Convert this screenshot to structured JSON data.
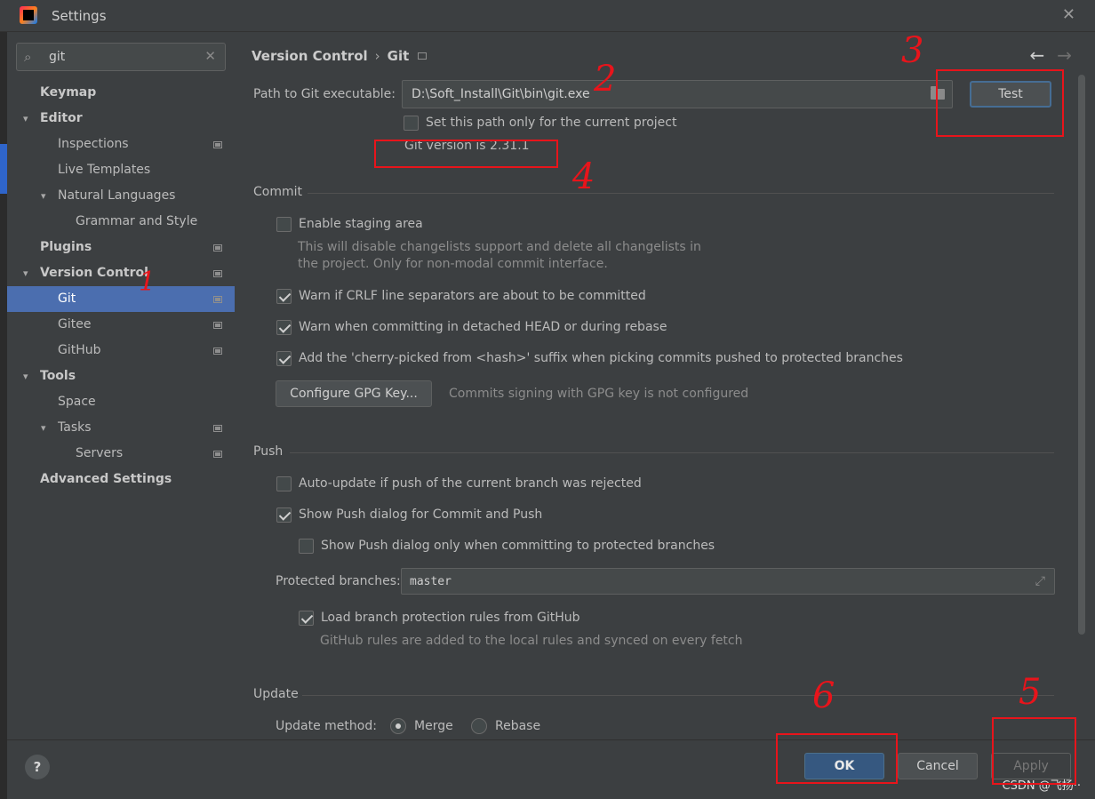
{
  "window": {
    "title": "Settings",
    "close_glyph": "✕"
  },
  "search": {
    "value": "git",
    "search_glyph": "⌕",
    "clear_glyph": "✕"
  },
  "tree": {
    "collapse_glyph": "▾",
    "items": [
      {
        "label": "Keymap"
      },
      {
        "label": "Editor"
      },
      {
        "label": "Inspections"
      },
      {
        "label": "Live Templates"
      },
      {
        "label": "Natural Languages"
      },
      {
        "label": "Grammar and Style"
      },
      {
        "label": "Plugins"
      },
      {
        "label": "Version Control"
      },
      {
        "label": "Git"
      },
      {
        "label": "Gitee"
      },
      {
        "label": "GitHub"
      },
      {
        "label": "Tools"
      },
      {
        "label": "Space"
      },
      {
        "label": "Tasks"
      },
      {
        "label": "Servers"
      },
      {
        "label": "Advanced Settings"
      }
    ]
  },
  "breadcrumb": {
    "parent": "Version Control",
    "separator": "›",
    "current": "Git",
    "back_glyph": "←",
    "forward_glyph": "→"
  },
  "git": {
    "path_label": "Path to Git executable:",
    "path_value": "D:\\Soft_Install\\Git\\bin\\git.exe",
    "test_button": "Test",
    "project_only_label": "Set this path only for the current project",
    "version_text": "Git version is 2.31.1"
  },
  "commit": {
    "section_title": "Commit",
    "staging_label": "Enable staging area",
    "staging_hint_1": "This will disable changelists support and delete all changelists in",
    "staging_hint_2": "the project. Only for non-modal commit interface.",
    "crlf_label": "Warn if CRLF line separators are about to be committed",
    "detached_label": "Warn when committing in detached HEAD or during rebase",
    "cherry_label": "Add the 'cherry-picked from <hash>' suffix when picking commits pushed to protected branches",
    "gpg_button": "Configure GPG Key...",
    "gpg_status": "Commits signing with GPG key is not configured"
  },
  "push": {
    "section_title": "Push",
    "auto_update_label": "Auto-update if push of the current branch was rejected",
    "show_dialog_label": "Show Push dialog for Commit and Push",
    "protected_only_label": "Show Push dialog only when committing to protected branches",
    "protected_branches_label": "Protected branches:",
    "protected_branches_value": "master",
    "expand_glyph": "⤢",
    "load_rules_label": "Load branch protection rules from GitHub",
    "load_rules_hint": "GitHub rules are added to the local rules and synced on every fetch"
  },
  "update": {
    "section_title": "Update",
    "method_label": "Update method:",
    "merge_label": "Merge",
    "rebase_label": "Rebase"
  },
  "footer": {
    "help": "?",
    "ok": "OK",
    "cancel": "Cancel",
    "apply": "Apply",
    "watermark": "CSDN @飞扬··"
  },
  "annotations": {
    "n1": "1",
    "n2": "2",
    "n3": "3",
    "n4": "4",
    "n5": "5",
    "n6": "6",
    "color": "#e8141b"
  },
  "colors": {
    "background": "#3c3f41",
    "selection": "#4b6eaf",
    "primary_button": "#365880"
  }
}
